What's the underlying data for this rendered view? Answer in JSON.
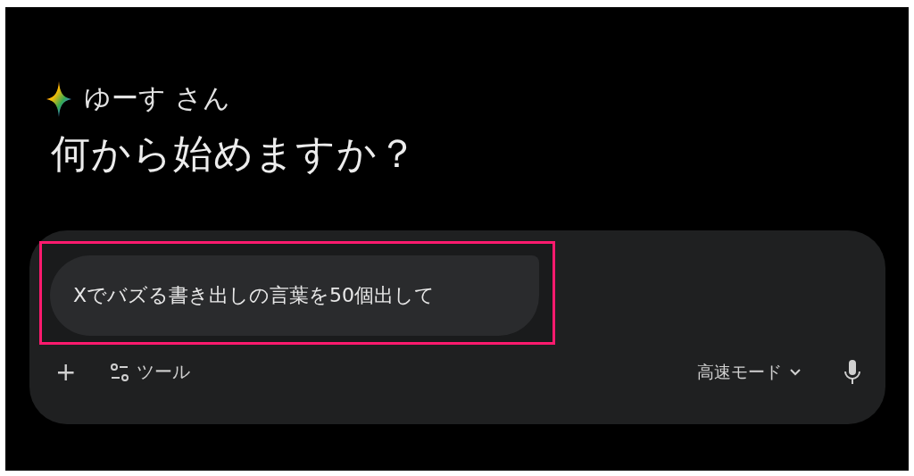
{
  "greeting": {
    "name": "ゆーす さん",
    "title": "何から始めますか？"
  },
  "composer": {
    "suggestion": "Xでバズる書き出しの言葉を50個出して",
    "highlighted": true,
    "add_button": "+",
    "tools_label": "ツール",
    "mode": "高速モード"
  }
}
